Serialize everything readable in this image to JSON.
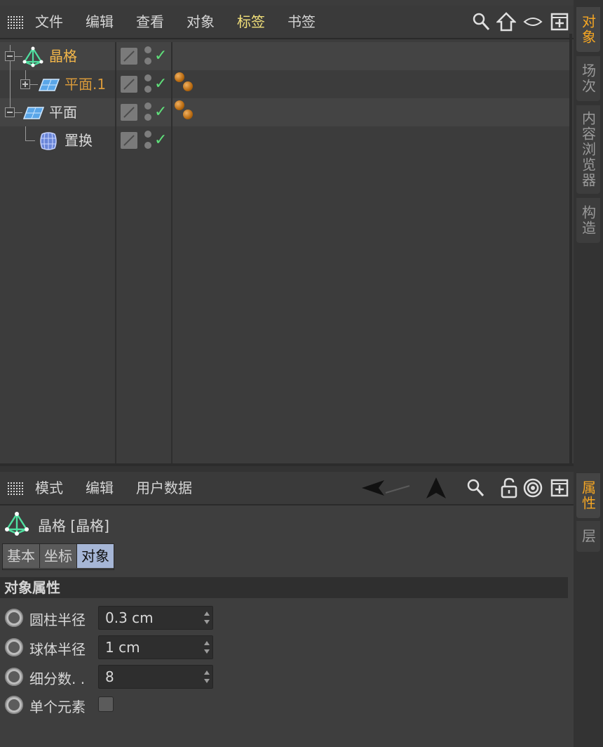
{
  "object_manager": {
    "menu": [
      "文件",
      "编辑",
      "查看",
      "对象",
      "标签",
      "书签"
    ],
    "active_menu": "标签",
    "toolbar_icons": [
      "search-icon",
      "home-icon",
      "eye-icon",
      "new-window-icon"
    ],
    "objects": [
      {
        "name": "晶格",
        "icon": "lattice-icon",
        "state": "selected",
        "has_tag": false
      },
      {
        "name": "平面.1",
        "icon": "plane-icon",
        "state": "child-selected",
        "has_tag": true
      },
      {
        "name": "平面",
        "icon": "plane-icon",
        "state": "normal",
        "has_tag": true
      },
      {
        "name": "置换",
        "icon": "displacer-icon",
        "state": "normal",
        "has_tag": false
      }
    ],
    "checkmark": "✓"
  },
  "side_tabs_top": [
    {
      "label": "对象",
      "active": true
    },
    {
      "label": "场次",
      "active": false
    },
    {
      "label": "内容浏览器",
      "active": false
    },
    {
      "label": "构造",
      "active": false
    }
  ],
  "side_tabs_bottom": [
    {
      "label": "属性",
      "active": true
    },
    {
      "label": "层",
      "active": false
    }
  ],
  "attribute_manager": {
    "menu": [
      "模式",
      "编辑",
      "用户数据"
    ],
    "toolbar_icons": [
      "back-arrow-icon",
      "up-arrow-icon",
      "search-icon",
      "lock-icon",
      "target-icon",
      "new-window-icon"
    ],
    "title": "晶格 [晶格]",
    "tabs": [
      "基本",
      "坐标",
      "对象"
    ],
    "active_tab": "对象",
    "section": "对象属性",
    "params": [
      {
        "label": "圆柱半径",
        "value": "0.3 cm",
        "type": "number"
      },
      {
        "label": "球体半径",
        "value": "1 cm",
        "type": "number"
      },
      {
        "label": "细分数. .",
        "value": "8",
        "type": "number"
      },
      {
        "label": "单个元素",
        "value": false,
        "type": "checkbox"
      }
    ]
  },
  "colors": {
    "accent_orange": "#f5a623",
    "selected_name": "#f5b84a",
    "active_menu": "#f2e07a",
    "check_green": "#5fe07a",
    "active_tab": "#a6b6d6"
  }
}
